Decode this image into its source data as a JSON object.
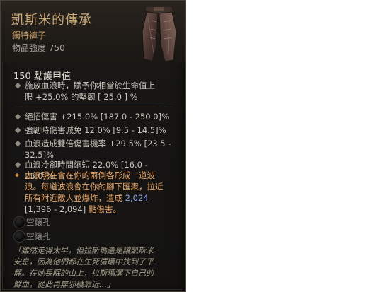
{
  "item": {
    "name": "凱斯米的傳承",
    "type": "獨特褲子",
    "power": "物品強度 750",
    "armor": "150 點護甲值",
    "implicit": [
      "施放血浪時，賦予你相當於生命值上",
      "限 +25.0% 的堅韌 [ 25.0 ] %"
    ],
    "affixes": [
      {
        "lines": [
          "絕招傷害 +215.0% [187.0 - 250.0]%"
        ]
      },
      {
        "lines": [
          "強韌時傷害減免 12.0% [9.5 - 14.5]%"
        ]
      },
      {
        "lines": [
          "血浪造成雙倍傷害機率 +29.5% [23.5 -",
          "32.5]%"
        ]
      },
      {
        "lines": [
          "血浪冷卻時間縮短 22.0% [16.0 - 25.0]%"
        ]
      }
    ],
    "unique_aspect": {
      "line1": "血浪現在會在你的兩側各形成一道波",
      "line2": "浪。每道波浪會在你的腳下匯聚，拉近",
      "line3a": "所有附近敵人並爆炸，造成 ",
      "damage": "2,024",
      "line4a": "[1,396 - 2,094]",
      "line4b": " 點傷害。"
    },
    "sockets": [
      "空鑲孔",
      "空鑲孔"
    ],
    "flavor": [
      "「雖然走得太早，但拉斯瑪還是讓凱斯米",
      "安息，因為他們都在生死循環中找到了平",
      "靜。在她長眠的山上，拉斯瑪灑下自己的",
      "鮮血，從此再無邪穢靠近…」"
    ]
  },
  "colors": {
    "unique_name": "#c9a878",
    "unique_type": "#c69c63",
    "aspect_text": "#e8a86a",
    "aspect_number": "#8fa4e6",
    "panel_bg": "#161514",
    "border": "#4a4237"
  },
  "icons": {
    "item_image": "unique-pants-icon",
    "bullet": "diamond-bullet-icon",
    "aspect_marker": "unique-aspect-star-icon",
    "socket": "empty-socket-icon"
  }
}
